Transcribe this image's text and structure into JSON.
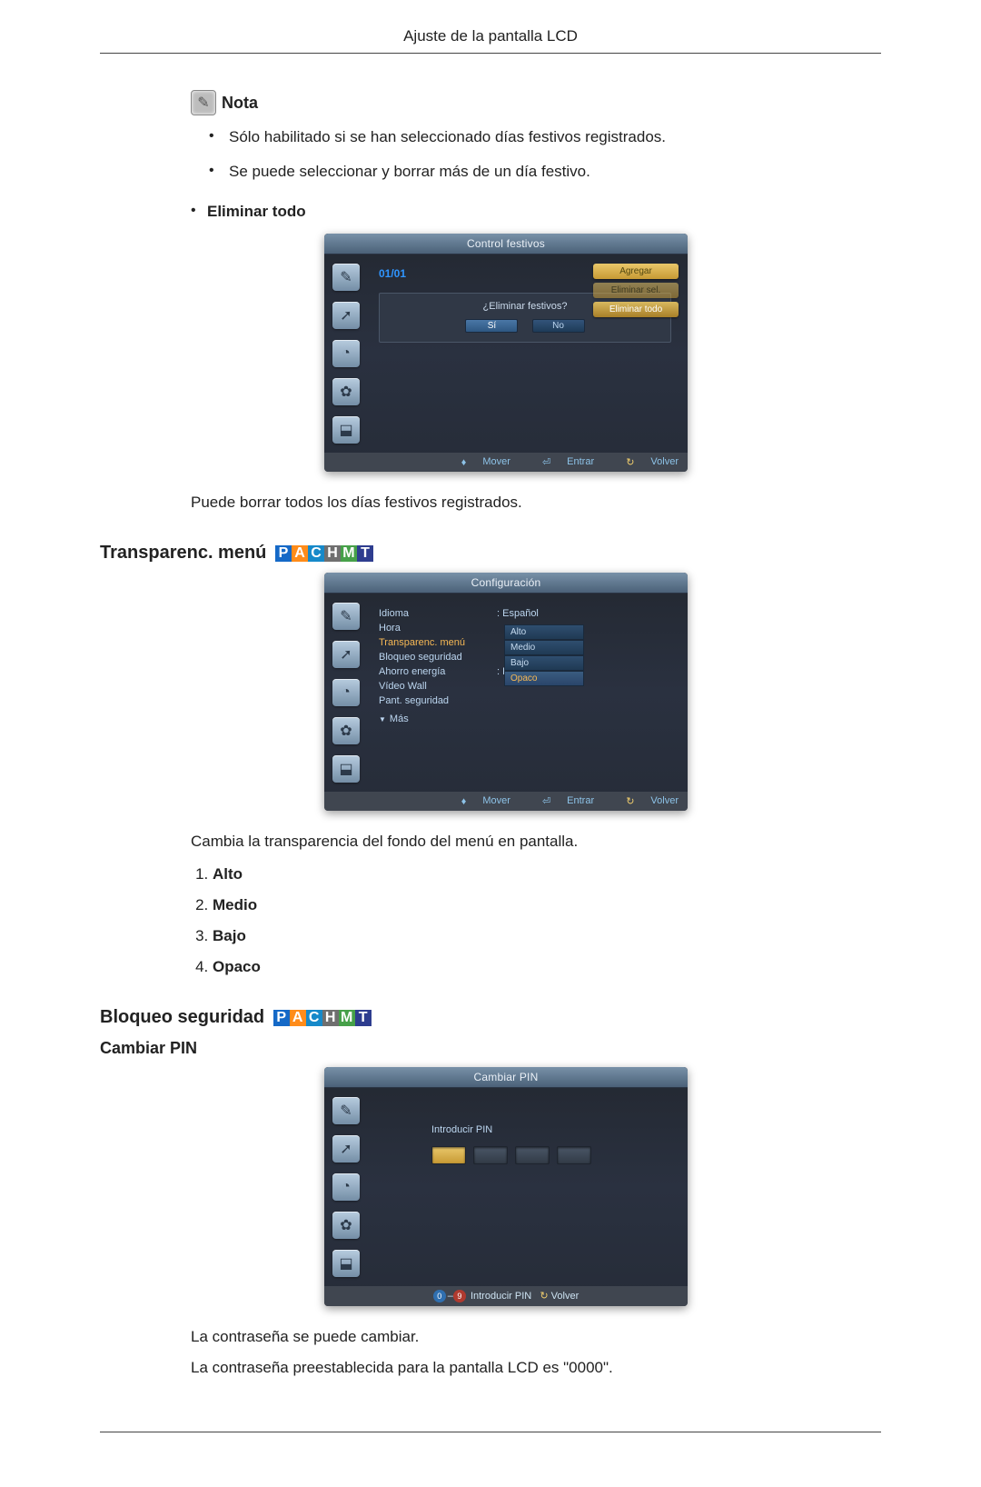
{
  "page_header": "Ajuste de la pantalla LCD",
  "note": {
    "label": "Nota",
    "items": [
      "Sólo habilitado si se han seleccionado días festivos registrados.",
      "Se puede seleccionar y borrar más de un día festivo."
    ]
  },
  "eliminar_todo": {
    "label": "Eliminar todo",
    "osd_title": "Control festivos",
    "date": "01/01",
    "right_buttons": {
      "agregar": "Agregar",
      "eliminar_sel": "Eliminar sel.",
      "eliminar_todo": "Eliminar  todo"
    },
    "dialog_question": "¿Eliminar festivos?",
    "dialog_yes": "Sí",
    "dialog_no": "No",
    "footer": {
      "mover": "Mover",
      "entrar": "Entrar",
      "volver": "Volver"
    },
    "caption": "Puede borrar todos los días festivos registrados."
  },
  "transparenc": {
    "heading": "Transparenc. menú",
    "osd_title": "Configuración",
    "rows": {
      "idioma": "Idioma",
      "idioma_val": "Español",
      "hora": "Hora",
      "transparenc": "Transparenc. menú",
      "bloqueo": "Bloqueo seguridad",
      "ahorro": "Ahorro energía",
      "ahorro_val": "Bajo",
      "video": "Vídeo Wall",
      "pant": "Pant. seguridad"
    },
    "options": [
      "Alto",
      "Medio",
      "Bajo",
      "Opaco"
    ],
    "mas": "Más",
    "footer": {
      "mover": "Mover",
      "entrar": "Entrar",
      "volver": "Volver"
    },
    "caption": "Cambia la transparencia del fondo del menú en pantalla.",
    "list": [
      "Alto",
      "Medio",
      "Bajo",
      "Opaco"
    ]
  },
  "bloqueo": {
    "heading": "Bloqueo seguridad",
    "sub": "Cambiar PIN",
    "osd_title": "Cambiar PIN",
    "introducir": "Introducir PIN",
    "foot_intro": "Introducir PIN",
    "foot_volver": "Volver",
    "text1": "La contraseña se puede cambiar.",
    "text2": "La contraseña preestablecida para la pantalla LCD es \"0000\"."
  },
  "icons": {
    "brush": "✎",
    "arrow": "➚",
    "circle": "◔",
    "gear": "✿",
    "chart": "⬓"
  }
}
